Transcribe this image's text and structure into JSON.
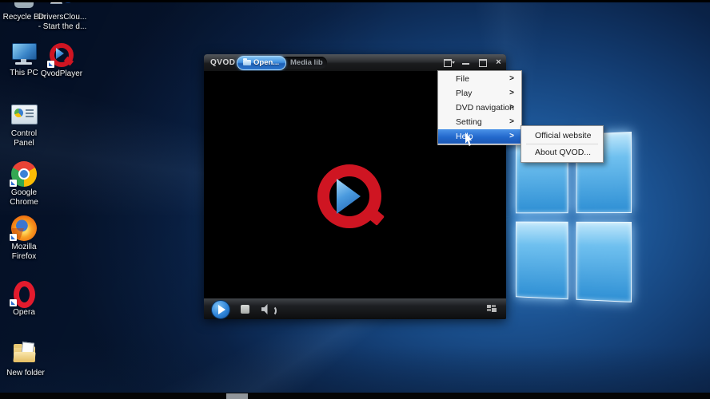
{
  "desktop": {
    "icons": [
      {
        "name": "recycle-bin",
        "label": "Recycle Bin"
      },
      {
        "name": "driverscloud",
        "label": "DriversClou...",
        "label2": "- Start the d..."
      },
      {
        "name": "this-pc",
        "label": "This PC"
      },
      {
        "name": "qvodplayer",
        "label": "QvodPlayer"
      },
      {
        "name": "control-panel",
        "label": "Control",
        "label2": "Panel"
      },
      {
        "name": "google-chrome",
        "label": "Google",
        "label2": "Chrome"
      },
      {
        "name": "mozilla-firefox",
        "label": "Mozilla",
        "label2": "Firefox"
      },
      {
        "name": "opera",
        "label": "Opera"
      },
      {
        "name": "new-folder",
        "label": "New folder"
      }
    ]
  },
  "player": {
    "title": "QVOD",
    "open_button": "Open...",
    "media_lib_tab": "Media lib",
    "close_glyph": "×"
  },
  "menu": {
    "arrow": ">",
    "items": [
      {
        "label": "File"
      },
      {
        "label": "Play"
      },
      {
        "label": "DVD navigation"
      },
      {
        "label": "Setting"
      },
      {
        "label": "Help",
        "highlighted": true
      }
    ]
  },
  "submenu": {
    "items": [
      {
        "label": "Official website"
      },
      {
        "label": "About QVOD..."
      }
    ]
  },
  "colors": {
    "qvod_red": "#cf1522",
    "accent_blue": "#2f84d8",
    "menu_highlight": "#2a6fd4",
    "wallpaper_deep": "#0a2247",
    "pane_blue": "#45a6e8"
  }
}
